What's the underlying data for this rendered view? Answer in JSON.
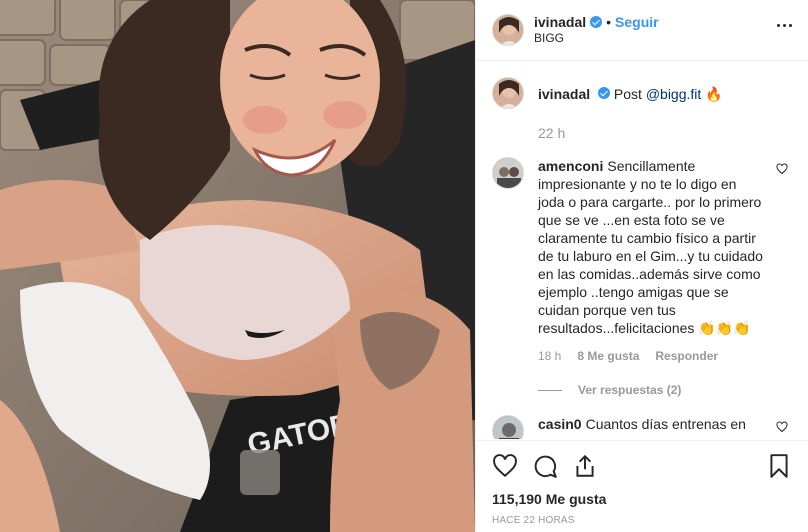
{
  "header": {
    "username": "ivinadal",
    "separator": "•",
    "follow_label": "Seguir",
    "location": "BIGG"
  },
  "caption": {
    "username": "ivinadal",
    "text": "Post ",
    "mention": "@bigg.fit",
    "emoji": "🔥",
    "timestamp": "22 h"
  },
  "comments": [
    {
      "username": "amenconi",
      "text": "Sencillamente impresionante y no te lo digo en joda o para cargarte.. por lo primero que se ve ...en esta foto se ve claramente tu cambio físico a partir de tu laburo en el Gim...y tu cuidado en las comidas..además sirve como ejemplo ..tengo amigas que se cuidan porque ven tus resultados...felicitaciones 👏👏👏",
      "time": "18 h",
      "likes": "8 Me gusta",
      "reply_label": "Responder",
      "view_replies": "Ver respuestas (2)"
    },
    {
      "username": "casin0",
      "text": "Cuantos días entrenas en"
    }
  ],
  "actions": {
    "like_count": "115,190",
    "likes_label": "Me gusta",
    "posted": "HACE 22 HORAS"
  },
  "icons": [
    "heart-icon",
    "comment-icon",
    "share-icon",
    "bookmark-icon",
    "more-options-icon",
    "verified-badge-icon"
  ],
  "colors": {
    "accent": "#3897f0",
    "text": "#262626",
    "muted": "#999999",
    "border": "#efefef"
  }
}
